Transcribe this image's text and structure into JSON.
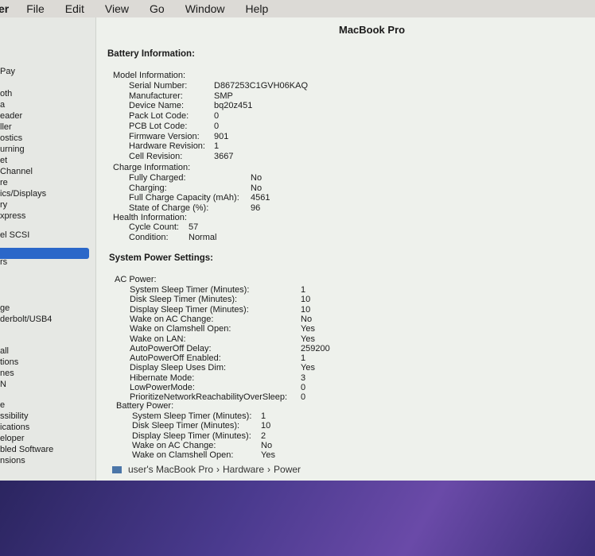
{
  "menubar": [
    "er",
    "File",
    "Edit",
    "View",
    "Go",
    "Window",
    "Help"
  ],
  "window_title": "MacBook Pro",
  "sidebar": {
    "items": [
      "Pay",
      "oth",
      "a",
      "eader",
      "ller",
      "ostics",
      "urning",
      "et",
      "Channel",
      "re",
      "ics/Displays",
      "ry",
      "xpress",
      "el SCSI",
      "",
      "rs",
      "ge",
      "derbolt/USB4",
      "all",
      "tions",
      "nes",
      "N",
      "",
      "e",
      "ssibility",
      "ications",
      "eloper",
      "bled Software",
      "nsions"
    ]
  },
  "battery": {
    "section_title": "Battery Information:",
    "model_title": "Model Information:",
    "model": [
      {
        "label": "Serial Number:",
        "value": "D867253C1GVH06KAQ"
      },
      {
        "label": "Manufacturer:",
        "value": "SMP"
      },
      {
        "label": "Device Name:",
        "value": "bq20z451"
      },
      {
        "label": "Pack Lot Code:",
        "value": "0"
      },
      {
        "label": "PCB Lot Code:",
        "value": "0"
      },
      {
        "label": "Firmware Version:",
        "value": "901"
      },
      {
        "label": "Hardware Revision:",
        "value": "1"
      },
      {
        "label": "Cell Revision:",
        "value": "3667"
      }
    ],
    "charge_title": "Charge Information:",
    "charge": [
      {
        "label": "Fully Charged:",
        "value": "No"
      },
      {
        "label": "Charging:",
        "value": "No"
      },
      {
        "label": "Full Charge Capacity (mAh):",
        "value": "4561"
      },
      {
        "label": "State of Charge (%):",
        "value": "96"
      }
    ],
    "health_title": "Health Information:",
    "health": [
      {
        "label": "Cycle Count:",
        "value": "57"
      },
      {
        "label": "Condition:",
        "value": "Normal"
      }
    ]
  },
  "power": {
    "section_title": "System Power Settings:",
    "ac_title": "AC Power:",
    "ac": [
      {
        "label": "System Sleep Timer (Minutes):",
        "value": "1"
      },
      {
        "label": "Disk Sleep Timer (Minutes):",
        "value": "10"
      },
      {
        "label": "Display Sleep Timer (Minutes):",
        "value": "10"
      },
      {
        "label": "Wake on AC Change:",
        "value": "No"
      },
      {
        "label": "Wake on Clamshell Open:",
        "value": "Yes"
      },
      {
        "label": "Wake on LAN:",
        "value": "Yes"
      },
      {
        "label": "AutoPowerOff Delay:",
        "value": "259200"
      },
      {
        "label": "AutoPowerOff Enabled:",
        "value": "1"
      },
      {
        "label": "Display Sleep Uses Dim:",
        "value": "Yes"
      },
      {
        "label": "Hibernate Mode:",
        "value": "3"
      },
      {
        "label": "LowPowerMode:",
        "value": "0"
      },
      {
        "label": "PrioritizeNetworkReachabilityOverSleep:",
        "value": "0"
      }
    ],
    "battery_title": "Battery Power:",
    "battery": [
      {
        "label": "System Sleep Timer (Minutes):",
        "value": "1"
      },
      {
        "label": "Disk Sleep Timer (Minutes):",
        "value": "10"
      },
      {
        "label": "Display Sleep Timer (Minutes):",
        "value": "2"
      },
      {
        "label": "Wake on AC Change:",
        "value": "No"
      },
      {
        "label": "Wake on Clamshell Open:",
        "value": "Yes"
      }
    ]
  },
  "path": [
    "user's MacBook Pro",
    "Hardware",
    "Power"
  ],
  "path_sep": "›"
}
